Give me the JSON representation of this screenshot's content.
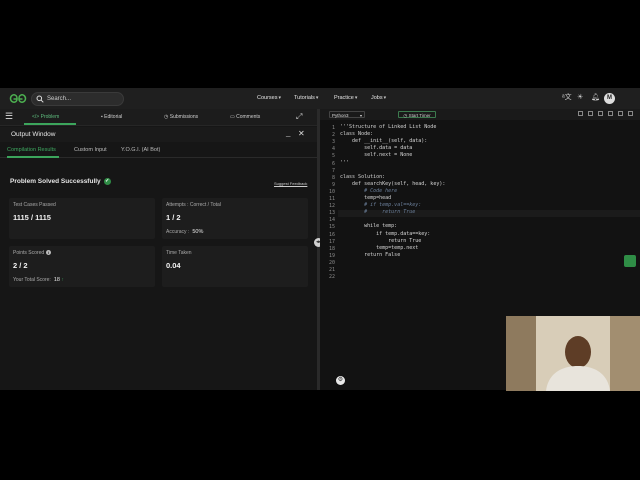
{
  "nav": {
    "search_placeholder": "Search...",
    "items": [
      "Courses",
      "Tutorials",
      "Practice",
      "Jobs"
    ],
    "chevron": "▾",
    "avatar_initial": "M",
    "icons": [
      "translate-icon",
      "theme-toggle-icon",
      "bell-icon"
    ]
  },
  "problem_tabs": {
    "items": [
      "Problem",
      "Editorial",
      "Submissions",
      "Comments"
    ],
    "active": "Problem"
  },
  "output_window": {
    "title": "Output Window",
    "tabs": [
      "Compilation Results",
      "Custom Input",
      "Y.O.G.I. (AI Bot)"
    ],
    "active_tab": "Compilation Results"
  },
  "results": {
    "headline": "Problem Solved Successfully",
    "feedback_link": "Suggest Feedback",
    "test_cases_label": "Test Cases Passed",
    "test_cases_value": "1115 / 1115",
    "attempts_label": "Attempts : Correct / Total",
    "attempts_value": "1 / 2",
    "accuracy_label": "Accuracy :",
    "accuracy_value": "50%",
    "points_label": "Points Scored",
    "points_value": "2 / 2",
    "total_score_label": "Your Total Score:",
    "total_score_value": "18",
    "time_label": "Time Taken",
    "time_value": "0.04"
  },
  "editor": {
    "language": "Python3",
    "timer_label": "Start Timer",
    "lines": [
      "'''Structure of Linked List Node",
      "class Node:",
      "    def __init__(self, data):",
      "        self.data = data",
      "        self.next = None",
      "'''",
      "",
      "class Solution:",
      "    def searchKey(self, head, key):",
      "        # Code here",
      "        temp=head",
      "        # if temp.val==key:",
      "        #     return True",
      "",
      "        while temp:",
      "            if temp.data==key:",
      "                return True",
      "            temp=temp.next",
      "        return False",
      "",
      "",
      ""
    ]
  },
  "colors": {
    "accent_green": "#2f8d46",
    "background": "#161616",
    "editor_background": "#121212"
  }
}
